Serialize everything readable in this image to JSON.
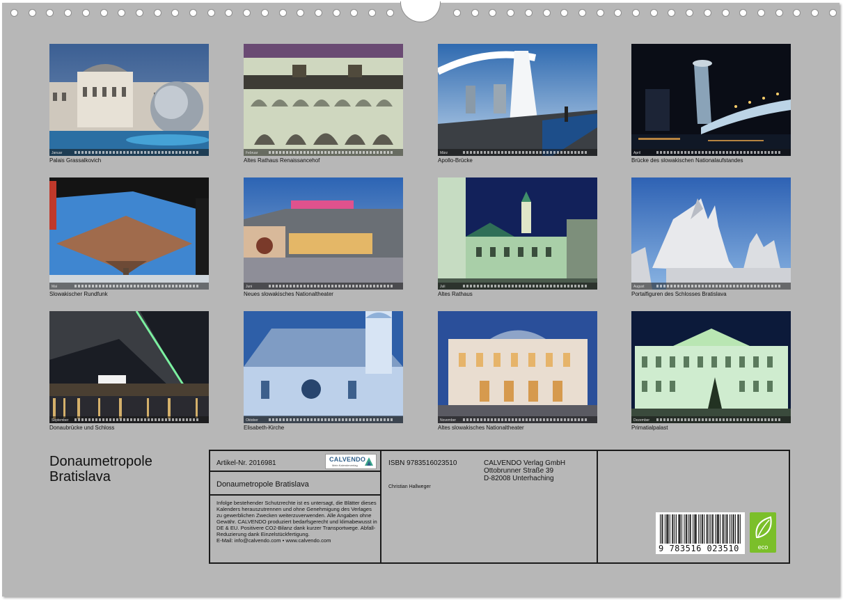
{
  "calendar": {
    "title": "Donaumetropole Bratislava"
  },
  "thumbnails": [
    {
      "caption": "Palais Grassalkovich",
      "month": "Januar"
    },
    {
      "caption": "Altes Rathaus Renaissancehof",
      "month": "Februar"
    },
    {
      "caption": "Apollo-Brücke",
      "month": "März"
    },
    {
      "caption": "Brücke des slowakischen Nationalaufstandes",
      "month": "April"
    },
    {
      "caption": "Slowakischer Rundfunk",
      "month": "Mai"
    },
    {
      "caption": "Neues slowakisches Nationaltheater",
      "month": "Juni"
    },
    {
      "caption": "Altes Rathaus",
      "month": "Juli"
    },
    {
      "caption": "Portalfiguren des Schlosses Bratislava",
      "month": "August"
    },
    {
      "caption": "Donaubrücke und Schloss",
      "month": "September"
    },
    {
      "caption": "Elisabeth-Kirche",
      "month": "Oktober"
    },
    {
      "caption": "Altes slowakisches Nationaltheater",
      "month": "November"
    },
    {
      "caption": "Primatialpalast",
      "month": "Dezember"
    }
  ],
  "info": {
    "article_no": "Artikel-Nr. 2016981",
    "logo_text": "CALVENDO",
    "logo_sub": "Mein Kalenderverlag",
    "title": "Donaumetropole Bratislava",
    "legal": "Infolge bestehender Schutzrechte ist es untersagt, die Blätter dieses Kalenders herauszutrennen und ohne Genehmigung des Verlages zu gewerblichen Zwecken weiterzuverwenden. Alle Angaben ohne Gewähr. CALVENDO produziert bedarfsgerecht und klimabewusst in DE & EU. Positivere CO2-Bilanz dank kurzer Transportwege. Abfall-Reduzierung dank Einzelstückfertigung.",
    "email": "E-Mail: info@calvendo.com • www.calvendo.com",
    "isbn": "ISBN 9783516023510",
    "author": "Christian Hallweger",
    "publisher_1": "CALVENDO Verlag GmbH",
    "publisher_2": "Ottobrunner Straße 39",
    "publisher_3": "D-82008 Unterhaching",
    "barcode_digits": "9 783516 023510",
    "eco_label": "eco"
  },
  "colors": {
    "page_bg": "#b7b7b7",
    "eco_green": "#7bbf2a",
    "logo_blue": "#2f5f8a"
  }
}
